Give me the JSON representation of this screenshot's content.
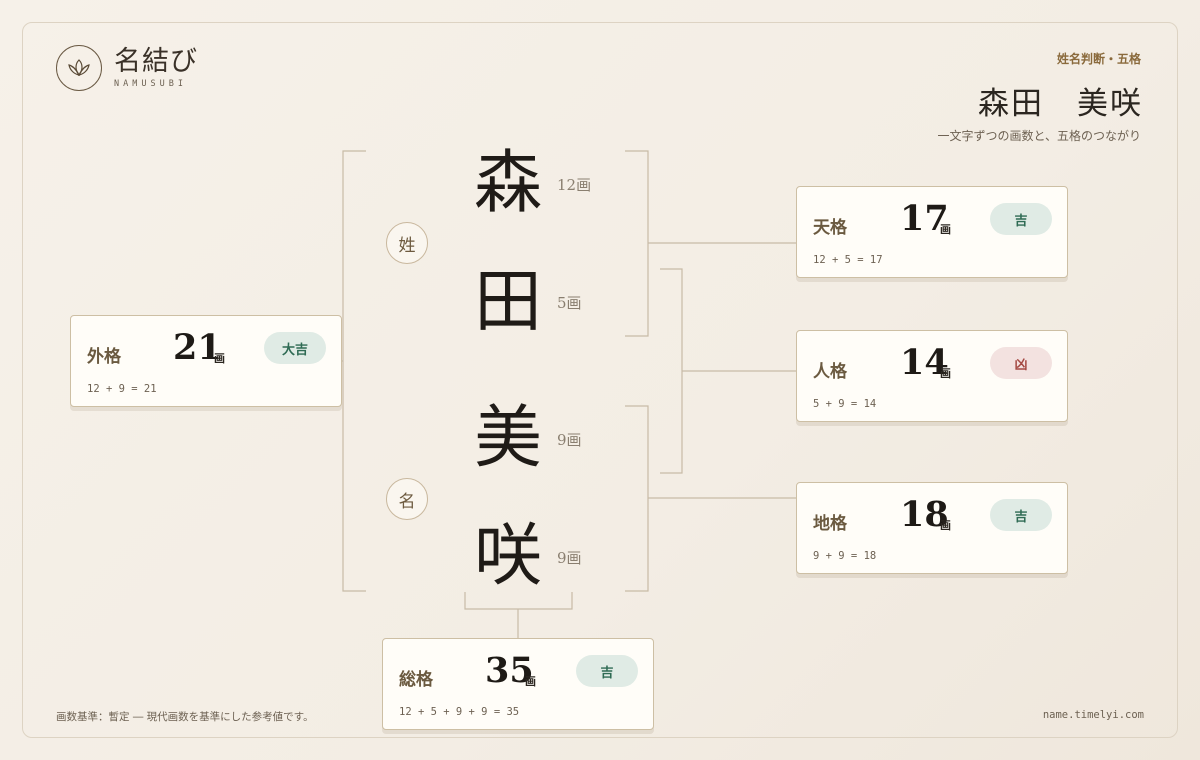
{
  "brand": {
    "name": "名結び",
    "sub": "NAMUSUBI",
    "logo_icon": "lotus-icon"
  },
  "header": {
    "kicker": "姓名判断・五格",
    "name": "森田　美咲",
    "description": "一文字ずつの画数と、五格のつながり"
  },
  "groups": {
    "surname": "姓",
    "given": "名"
  },
  "characters": [
    {
      "char": "森",
      "strokes": "12画"
    },
    {
      "char": "田",
      "strokes": "5画"
    },
    {
      "char": "美",
      "strokes": "9画"
    },
    {
      "char": "咲",
      "strokes": "9画"
    }
  ],
  "cards": {
    "gaikaku": {
      "name": "外格",
      "value": "21",
      "unit": "画",
      "badge": "大吉",
      "formula": "12 + 9 = 21"
    },
    "tenkaku": {
      "name": "天格",
      "value": "17",
      "unit": "画",
      "badge": "吉",
      "formula": "12 + 5 = 17"
    },
    "jinkaku": {
      "name": "人格",
      "value": "14",
      "unit": "画",
      "badge": "凶",
      "formula": "5 + 9 = 14"
    },
    "chikaku": {
      "name": "地格",
      "value": "18",
      "unit": "画",
      "badge": "吉",
      "formula": "9 + 9 = 18"
    },
    "soukaku": {
      "name": "総格",
      "value": "35",
      "unit": "画",
      "badge": "吉",
      "formula": "12 + 5 + 9 + 9 = 35"
    }
  },
  "colors": {
    "good_badge_bg": "#e0ebe5",
    "good_badge_text": "#2f6b54",
    "bad_badge_bg": "#f3e2e0",
    "bad_badge_text": "#a54a44",
    "accent": "#8a6a3c"
  },
  "footer": {
    "note": "画数基準：暫定 ― 現代画数を基準にした参考値です。",
    "url": "name.timelyi.com"
  }
}
